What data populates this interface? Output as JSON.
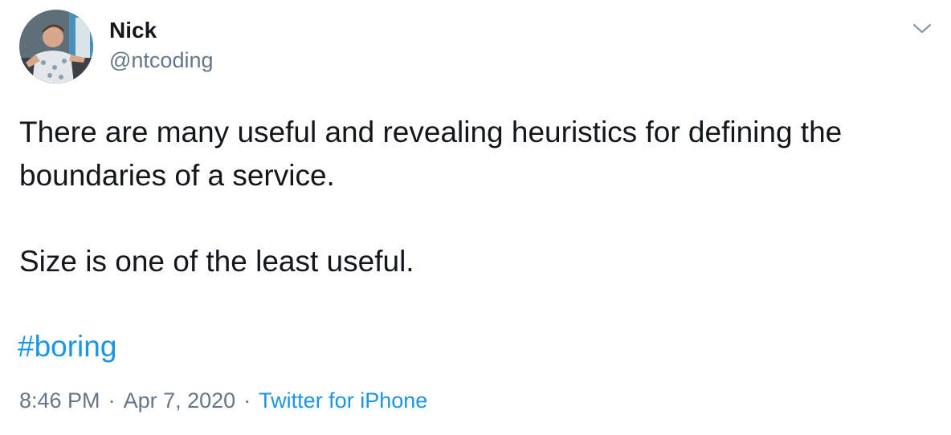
{
  "author": {
    "name": "Nick",
    "handle": "@ntcoding"
  },
  "tweet": {
    "text_line1": "There are many useful and revealing heuristics for defining the",
    "text_line2": "boundaries of a service.",
    "text_para2": "Size is one of the least useful.",
    "hashtag": "#boring"
  },
  "meta": {
    "time": "8:46 PM",
    "separator": "·",
    "date": "Apr 7, 2020",
    "source": "Twitter for iPhone"
  },
  "colors": {
    "text": "#14171a",
    "secondary": "#657786",
    "link": "#1b95e0"
  },
  "icons": {
    "menu": "chevron-down-icon"
  }
}
